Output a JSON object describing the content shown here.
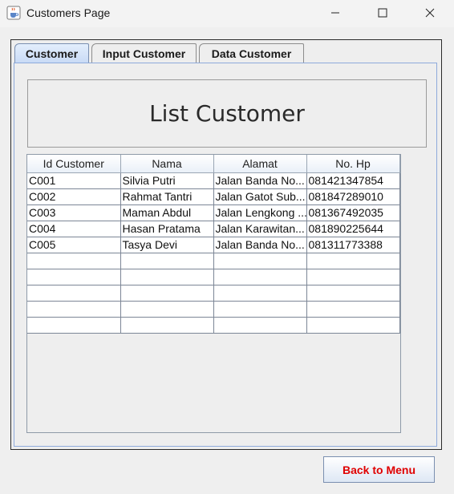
{
  "window": {
    "title": "Customers Page",
    "icon": "java-cup-icon"
  },
  "tabs": [
    {
      "label": "Customer",
      "active": true
    },
    {
      "label": "Input Customer",
      "active": false
    },
    {
      "label": "Data Customer",
      "active": false
    }
  ],
  "panel": {
    "header_title": "List Customer"
  },
  "table": {
    "columns": [
      "Id Customer",
      "Nama",
      "Alamat",
      "No. Hp"
    ],
    "rows": [
      [
        "C001",
        "Silvia Putri",
        "Jalan Banda No...",
        "081421347854"
      ],
      [
        "C002",
        "Rahmat Tantri",
        "Jalan Gatot Sub...",
        "081847289010"
      ],
      [
        "C003",
        "Maman Abdul",
        "Jalan Lengkong ...",
        "081367492035"
      ],
      [
        "C004",
        "Hasan Pratama",
        "Jalan Karawitan...",
        "081890225644"
      ],
      [
        "C005",
        "Tasya Devi",
        "Jalan Banda No...",
        "081311773388"
      ],
      [
        "",
        "",
        "",
        ""
      ],
      [
        "",
        "",
        "",
        ""
      ],
      [
        "",
        "",
        "",
        ""
      ],
      [
        "",
        "",
        "",
        ""
      ],
      [
        "",
        "",
        "",
        ""
      ]
    ]
  },
  "buttons": {
    "back_label": "Back to Menu"
  },
  "colors": {
    "back_text": "#e00000",
    "active_tab": "#c9dbf6",
    "panel_border": "#8eaadb"
  }
}
